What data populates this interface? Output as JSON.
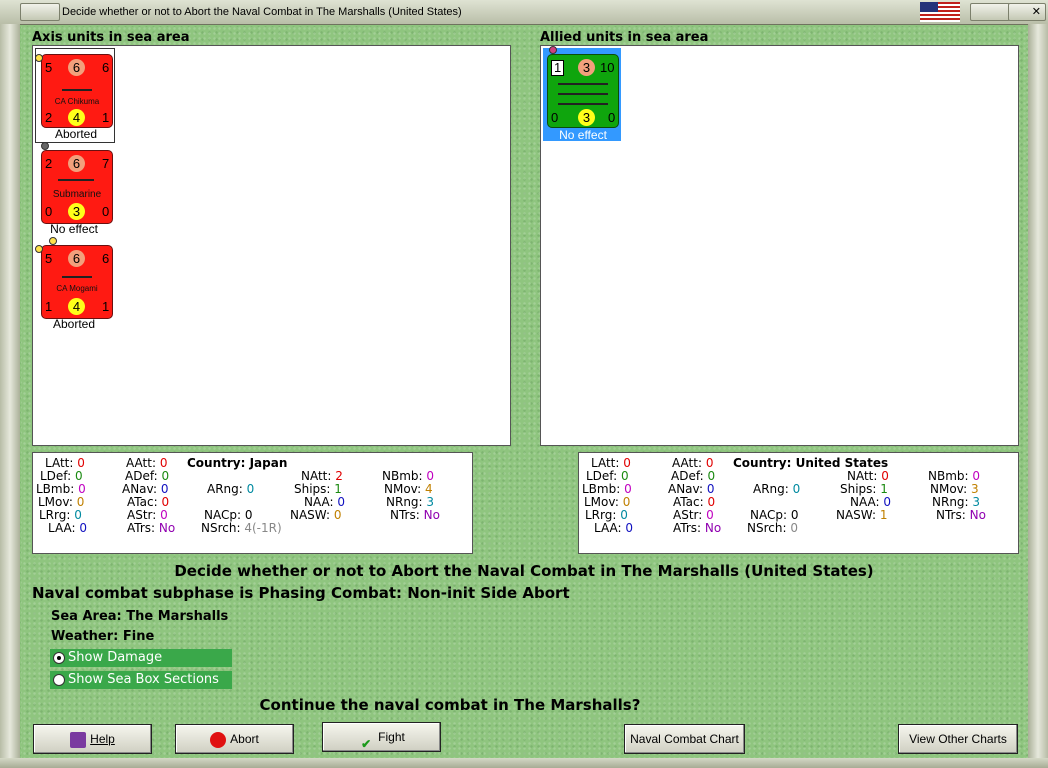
{
  "window": {
    "title": "Decide whether or not to Abort the Naval Combat in The Marshalls (United States)"
  },
  "axis": {
    "heading": "Axis units in sea area",
    "units": [
      {
        "top_left": "5",
        "top_mid": "6",
        "top_right": "6",
        "name": "CA Chikuma",
        "bot_left": "2",
        "bot_mid": "4",
        "bot_right": "1",
        "status": "Aborted"
      },
      {
        "top_left": "2",
        "top_mid": "6",
        "top_right": "7",
        "name": "Submarine",
        "bot_left": "0",
        "bot_mid": "3",
        "bot_right": "0",
        "status": "No effect"
      },
      {
        "top_left": "5",
        "top_mid": "6",
        "top_right": "6",
        "name": "CA Mogami",
        "bot_left": "1",
        "bot_mid": "4",
        "bot_right": "1",
        "status": "Aborted"
      }
    ],
    "stats": {
      "country": "Country: Japan",
      "latt": "LAtt:",
      "latt_v": "0",
      "ldef": "LDef:",
      "ldef_v": "0",
      "lbmb": "LBmb:",
      "lbmb_v": "0",
      "lmov": "LMov:",
      "lmov_v": "0",
      "lrrg": "LRrg:",
      "lrrg_v": "0",
      "laa": "LAA:",
      "laa_v": "0",
      "aatt": "AAtt:",
      "aatt_v": "0",
      "adef": "ADef:",
      "adef_v": "0",
      "anav": "ANav:",
      "anav_v": "0",
      "atac": "ATac:",
      "atac_v": "0",
      "astr": "AStr:",
      "astr_v": "0",
      "atrs": "ATrs:",
      "atrs_v": "No",
      "arng": "ARng:",
      "arng_v": "0",
      "nacp": "NACp:",
      "nacp_v": "0",
      "nsrch": "NSrch:",
      "nsrch_v": "4(-1R)",
      "natt": "NAtt:",
      "natt_v": "2",
      "ships": "Ships:",
      "ships_v": "1",
      "naa": "NAA:",
      "naa_v": "0",
      "nasw": "NASW:",
      "nasw_v": "0",
      "nbmb": "NBmb:",
      "nbmb_v": "0",
      "nmov": "NMov:",
      "nmov_v": "4",
      "nrng": "NRng:",
      "nrng_v": "3",
      "ntrs": "NTrs:",
      "ntrs_v": "No"
    }
  },
  "allied": {
    "heading": "Allied units in sea area",
    "units": [
      {
        "top_left": "1",
        "top_mid": "3",
        "top_right": "10",
        "bot_left": "0",
        "bot_mid": "3",
        "bot_right": "0",
        "status": "No effect"
      }
    ],
    "stats": {
      "country": "Country: United States",
      "latt": "LAtt:",
      "latt_v": "0",
      "ldef": "LDef:",
      "ldef_v": "0",
      "lbmb": "LBmb:",
      "lbmb_v": "0",
      "lmov": "LMov:",
      "lmov_v": "0",
      "lrrg": "LRrg:",
      "lrrg_v": "0",
      "laa": "LAA:",
      "laa_v": "0",
      "aatt": "AAtt:",
      "aatt_v": "0",
      "adef": "ADef:",
      "adef_v": "0",
      "anav": "ANav:",
      "anav_v": "0",
      "atac": "ATac:",
      "atac_v": "0",
      "astr": "AStr:",
      "astr_v": "0",
      "atrs": "ATrs:",
      "atrs_v": "No",
      "arng": "ARng:",
      "arng_v": "0",
      "nacp": "NACp:",
      "nacp_v": "0",
      "nsrch": "NSrch:",
      "nsrch_v": "0",
      "natt": "NAtt:",
      "natt_v": "0",
      "ships": "Ships:",
      "ships_v": "1",
      "naa": "NAA:",
      "naa_v": "0",
      "nasw": "NASW:",
      "nasw_v": "1",
      "nbmb": "NBmb:",
      "nbmb_v": "0",
      "nmov": "NMov:",
      "nmov_v": "3",
      "nrng": "NRng:",
      "nrng_v": "3",
      "ntrs": "NTrs:",
      "ntrs_v": "No"
    }
  },
  "messages": {
    "decide": "Decide whether or not to Abort the Naval Combat in The Marshalls (United States)",
    "subphase": "Naval combat subphase is Phasing Combat: Non-init Side Abort",
    "sea_area_label": "Sea Area:",
    "sea_area_value": "The Marshalls",
    "weather_label": "Weather:",
    "weather_value": "Fine",
    "continue": "Continue the naval combat in The Marshalls?"
  },
  "options": {
    "show_damage": "Show Damage",
    "show_sea_box": "Show Sea Box Sections",
    "selected": "Show Damage"
  },
  "buttons": {
    "help": "Help",
    "abort": "Abort",
    "fight": "Fight",
    "naval_chart": "Naval Combat Chart",
    "other_charts": "View Other Charts"
  },
  "icons": {
    "flag": "us-flag-icon",
    "help": "book-icon",
    "abort": "no-entry-icon",
    "fight": "checkmark-icon"
  }
}
